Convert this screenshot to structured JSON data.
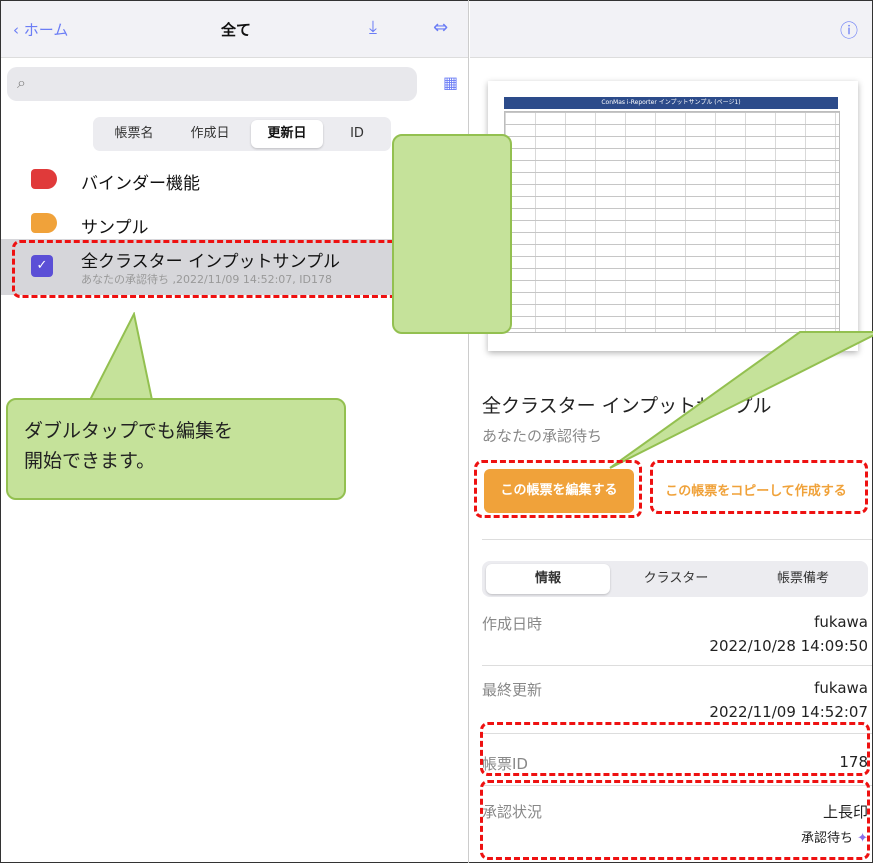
{
  "left": {
    "nav_back": "ホーム",
    "title": "全て",
    "segments": [
      "帳票名",
      "作成日",
      "更新日",
      "ID"
    ],
    "selected_segment": "更新日",
    "rows": [
      {
        "label": "バインダー機能",
        "color": "#e03a3a"
      },
      {
        "label": "サンプル",
        "color": "#f0a23a"
      },
      {
        "label": "全クラスター インプットサンプル",
        "subtitle": "あなたの承認待ち ,2022/11/09 14:52:07, ID178"
      }
    ],
    "callout": "ダブルタップでも編集を\n開始できます。"
  },
  "right": {
    "preview_header": "ConMas i-Reporter インプットサンプル (ページ1)",
    "doc_title": "全クラスター インプットサンプル",
    "doc_status": "あなたの承認待ち",
    "edit_button": "この帳票を編集する",
    "copy_button": "この帳票をコピーして作成する",
    "tabs": [
      "情報",
      "クラスター",
      "帳票備考"
    ],
    "info": {
      "created_label": "作成日時",
      "created_user": "fukawa",
      "created_at": "2022/10/28 14:09:50",
      "updated_label": "最終更新",
      "updated_user": "fukawa",
      "updated_at": "2022/11/09 14:52:07",
      "id_label": "帳票ID",
      "id_value": "178",
      "approval_label": "承認状況",
      "approval_value": "上長印",
      "approval_status": "承認待ち"
    }
  },
  "colors": {
    "accent": "#6b7df5",
    "orange": "#f0a23a",
    "red_dash": "#e11111",
    "callout": "#c5e29a"
  }
}
